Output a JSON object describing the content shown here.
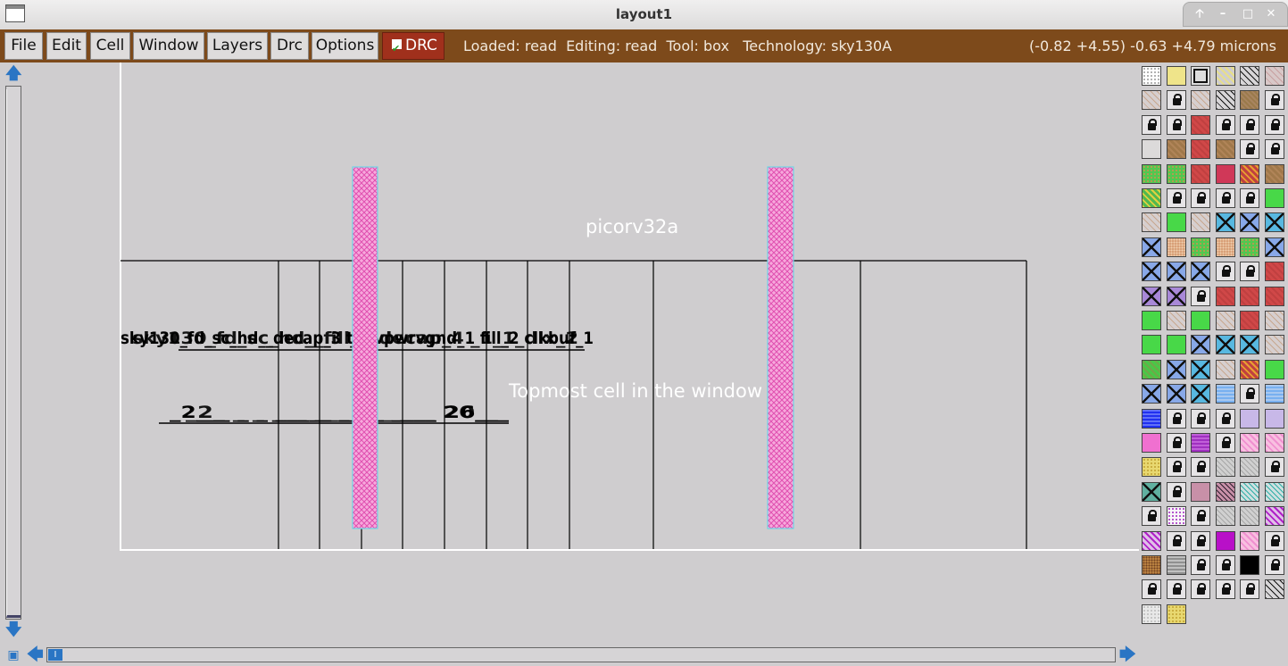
{
  "window": {
    "title": "layout1"
  },
  "menu": {
    "items": [
      {
        "id": "file",
        "label": "File"
      },
      {
        "id": "edit",
        "label": "Edit"
      },
      {
        "id": "cell",
        "label": "Cell"
      },
      {
        "id": "window",
        "label": "Window"
      },
      {
        "id": "layers",
        "label": "Layers"
      },
      {
        "id": "drc",
        "label": "Drc"
      },
      {
        "id": "options",
        "label": "Options"
      }
    ],
    "drc_toggle": {
      "label": "DRC",
      "checked": true
    }
  },
  "status": {
    "text": "Loaded: read  Editing: read  Tool: box   Technology: sky130A",
    "coords": "(-0.82 +4.55) -0.63 +4.79 microns"
  },
  "layout": {
    "top_cell_name": "picorv32a",
    "window_hint": "Topmost cell in the window",
    "overlapping_labels_row1": "sky130_fd_sc_hd__decap_3 / tapvpwrvgnd_1 / fill_2 / clkbuf_1",
    "overlapping_labels_row2": "_2__ _2__ _2___ __ 26___"
  },
  "colors": {
    "menubar": "#7d4a1b",
    "drc_button": "#a0301c",
    "metal_stripe": "#f28ad0",
    "canvas": "#cfcdcf"
  },
  "palette": {
    "swatches": [
      [
        "dots",
        "yellow",
        "outline",
        "yellowhatch",
        "diag",
        "pinkish"
      ],
      [
        "tan",
        "lock",
        "tan",
        "diag",
        "brownhatch",
        "lock"
      ],
      [
        "lock",
        "lock",
        "red",
        "lock",
        "lock",
        "lock"
      ],
      [
        "grey",
        "brown",
        "red",
        "brown",
        "lock",
        "lock"
      ],
      [
        "greendots",
        "greendots",
        "red",
        "crimson",
        "orangehatch",
        "brown"
      ],
      [
        "yellowgreen",
        "lock",
        "lock",
        "lock",
        "lock",
        "green"
      ],
      [
        "tan",
        "green",
        "tan",
        "cyanx",
        "bluex",
        "cyanx"
      ],
      [
        "bluex",
        "tandots",
        "greendots",
        "tandots",
        "greendots",
        "bluex"
      ],
      [
        "bluex",
        "bluex",
        "bluex",
        "lock",
        "lock",
        "red"
      ],
      [
        "purplex",
        "purplex",
        "lock",
        "red",
        "red",
        "red"
      ],
      [
        "green",
        "tan",
        "green",
        "tan",
        "red",
        "tan"
      ],
      [
        "green",
        "green",
        "bluex",
        "cyanx",
        "cyanx",
        "tan"
      ],
      [
        "greenhatch",
        "bluex",
        "cyanx",
        "tan",
        "orangehatch",
        "green"
      ],
      [
        "bluex",
        "bluex",
        "cyanx",
        "wave",
        "lock",
        "wave"
      ],
      [
        "bluewave",
        "lock",
        "lock",
        "lock",
        "lilac",
        "lilac"
      ],
      [
        "pink",
        "lock",
        "magentawave",
        "lock",
        "pinkhatch",
        "pinkhatch"
      ],
      [
        "yellowdots",
        "lock",
        "lock",
        "greyhatch",
        "greyhatch",
        "lock"
      ],
      [
        "tealx",
        "lock",
        "mauve",
        "mauvehatch",
        "tealhatch",
        "tealhatch"
      ],
      [
        "lock",
        "purpledots",
        "lock",
        "greyhatch",
        "greyhatch",
        "purplehatch"
      ],
      [
        "purplehatch",
        "lock",
        "lock",
        "magenta",
        "pinkhatch",
        "lock"
      ],
      [
        "browndots",
        "greywave",
        "lock",
        "lock",
        "black",
        "lock"
      ],
      [
        "lock",
        "lock",
        "lock",
        "lock",
        "lock",
        "diag"
      ],
      [
        "lightdots",
        "yellowdots"
      ]
    ]
  }
}
